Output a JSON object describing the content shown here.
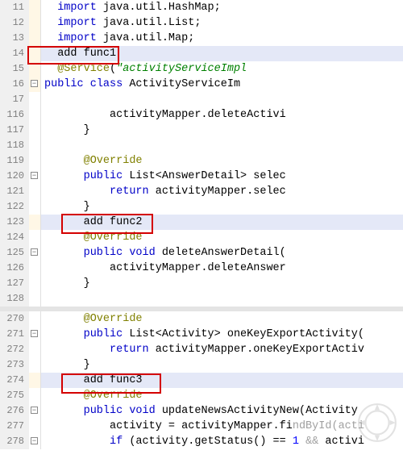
{
  "lines": [
    {
      "n": 11,
      "fold": "",
      "tracked": true,
      "hl": false,
      "tokens": [
        [
          "sp",
          2
        ],
        [
          "kw",
          "import"
        ],
        [
          "txt",
          " java.util.HashMap;"
        ]
      ]
    },
    {
      "n": 12,
      "fold": "",
      "tracked": true,
      "hl": false,
      "tokens": [
        [
          "sp",
          2
        ],
        [
          "kw",
          "import"
        ],
        [
          "txt",
          " java.util.List;"
        ]
      ]
    },
    {
      "n": 13,
      "fold": "",
      "tracked": true,
      "hl": false,
      "tokens": [
        [
          "sp",
          2
        ],
        [
          "kw",
          "import"
        ],
        [
          "txt",
          " java.util.Map;"
        ]
      ]
    },
    {
      "n": 14,
      "fold": "",
      "tracked": true,
      "hl": true,
      "box": true,
      "tokens": [
        [
          "sp",
          2
        ],
        [
          "txt",
          "add func1"
        ]
      ]
    },
    {
      "n": 15,
      "fold": "",
      "tracked": true,
      "hl": false,
      "tokens": [
        [
          "sp",
          2
        ],
        [
          "ann",
          "@Service"
        ],
        [
          "txt",
          "("
        ],
        [
          "str",
          "\"activityServiceImpl"
        ]
      ]
    },
    {
      "n": 16,
      "fold": "-",
      "tracked": true,
      "hl": false,
      "tokens": [
        [
          "kw",
          "public"
        ],
        [
          "txt",
          " "
        ],
        [
          "kw",
          "class"
        ],
        [
          "txt",
          " ActivityServiceIm"
        ]
      ]
    },
    {
      "n": 17,
      "fold": "",
      "tracked": false,
      "hl": false,
      "tokens": []
    },
    {
      "n": 116,
      "fold": "",
      "tracked": false,
      "hl": false,
      "tokens": [
        [
          "sp",
          10
        ],
        [
          "txt",
          "activityMapper.deleteActivi"
        ]
      ]
    },
    {
      "n": 117,
      "fold": "",
      "tracked": false,
      "hl": false,
      "tokens": [
        [
          "sp",
          6
        ],
        [
          "txt",
          "}"
        ]
      ]
    },
    {
      "n": 118,
      "fold": "",
      "tracked": false,
      "hl": false,
      "tokens": []
    },
    {
      "n": 119,
      "fold": "",
      "tracked": false,
      "hl": false,
      "tokens": [
        [
          "sp",
          6
        ],
        [
          "ann",
          "@Override"
        ]
      ]
    },
    {
      "n": 120,
      "fold": "-",
      "tracked": false,
      "hl": false,
      "tokens": [
        [
          "sp",
          6
        ],
        [
          "kw",
          "public"
        ],
        [
          "txt",
          " List<AnswerDetail> selec"
        ]
      ]
    },
    {
      "n": 121,
      "fold": "",
      "tracked": false,
      "hl": false,
      "tokens": [
        [
          "sp",
          10
        ],
        [
          "kw",
          "return"
        ],
        [
          "txt",
          " activityMapper.selec"
        ]
      ]
    },
    {
      "n": 122,
      "fold": "",
      "tracked": false,
      "hl": false,
      "tokens": [
        [
          "sp",
          6
        ],
        [
          "txt",
          "}"
        ]
      ]
    },
    {
      "n": 123,
      "fold": "",
      "tracked": true,
      "hl": true,
      "box": true,
      "tokens": [
        [
          "sp",
          6
        ],
        [
          "txt",
          "add func2"
        ]
      ]
    },
    {
      "n": 124,
      "fold": "",
      "tracked": false,
      "hl": false,
      "tokens": [
        [
          "sp",
          6
        ],
        [
          "ann",
          "@Override"
        ]
      ]
    },
    {
      "n": 125,
      "fold": "-",
      "tracked": false,
      "hl": false,
      "tokens": [
        [
          "sp",
          6
        ],
        [
          "kw",
          "public"
        ],
        [
          "txt",
          " "
        ],
        [
          "kw",
          "void"
        ],
        [
          "txt",
          " deleteAnswerDetail("
        ]
      ]
    },
    {
      "n": 126,
      "fold": "",
      "tracked": false,
      "hl": false,
      "tokens": [
        [
          "sp",
          10
        ],
        [
          "txt",
          "activityMapper.deleteAnswer"
        ]
      ]
    },
    {
      "n": 127,
      "fold": "",
      "tracked": false,
      "hl": false,
      "tokens": [
        [
          "sp",
          6
        ],
        [
          "txt",
          "}"
        ]
      ]
    },
    {
      "n": 128,
      "fold": "",
      "tracked": false,
      "hl": false,
      "tokens": []
    }
  ],
  "lines2": [
    {
      "n": 270,
      "fold": "",
      "tracked": false,
      "hl": false,
      "tokens": [
        [
          "sp",
          6
        ],
        [
          "ann",
          "@Override"
        ]
      ]
    },
    {
      "n": 271,
      "fold": "-",
      "tracked": false,
      "hl": false,
      "tokens": [
        [
          "sp",
          6
        ],
        [
          "kw",
          "public"
        ],
        [
          "txt",
          " List<Activity> oneKeyExportActivity("
        ]
      ]
    },
    {
      "n": 272,
      "fold": "",
      "tracked": false,
      "hl": false,
      "tokens": [
        [
          "sp",
          10
        ],
        [
          "kw",
          "return"
        ],
        [
          "txt",
          " activityMapper.oneKeyExportActiv"
        ]
      ]
    },
    {
      "n": 273,
      "fold": "",
      "tracked": false,
      "hl": false,
      "tokens": [
        [
          "sp",
          6
        ],
        [
          "txt",
          "}"
        ]
      ]
    },
    {
      "n": 274,
      "fold": "",
      "tracked": true,
      "hl": true,
      "box": true,
      "tokens": [
        [
          "sp",
          6
        ],
        [
          "txt",
          "add func3"
        ]
      ]
    },
    {
      "n": 275,
      "fold": "",
      "tracked": false,
      "hl": false,
      "tokens": [
        [
          "sp",
          6
        ],
        [
          "ann",
          "@Override"
        ]
      ]
    },
    {
      "n": 276,
      "fold": "-",
      "tracked": false,
      "hl": false,
      "tokens": [
        [
          "sp",
          6
        ],
        [
          "kw",
          "public"
        ],
        [
          "txt",
          " "
        ],
        [
          "kw",
          "void"
        ],
        [
          "txt",
          " updateNewsActivityNew(Activity "
        ]
      ]
    },
    {
      "n": 277,
      "fold": "",
      "tracked": false,
      "hl": false,
      "tokens": [
        [
          "sp",
          10
        ],
        [
          "txt",
          "activity = activityMapper.fi"
        ],
        [
          "dim",
          "ndById(acti"
        ]
      ]
    },
    {
      "n": 278,
      "fold": "-",
      "tracked": false,
      "hl": false,
      "tokens": [
        [
          "sp",
          10
        ],
        [
          "kw",
          "if"
        ],
        [
          "txt",
          " (activity.getStatus() == "
        ],
        [
          "num",
          "1"
        ],
        [
          "txt",
          " "
        ],
        [
          "dim",
          "&&"
        ],
        [
          "txt",
          " activi"
        ]
      ]
    }
  ],
  "annotations": {
    "box1_label": "add func1",
    "box2_label": "add func2",
    "box3_label": "add func3"
  },
  "icons": {
    "fold_minus": "−",
    "fold_plus": "+"
  }
}
